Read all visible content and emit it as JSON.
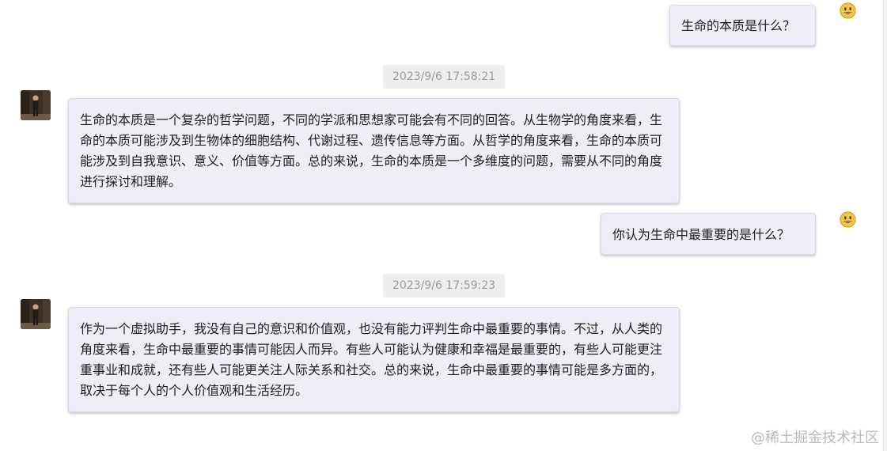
{
  "messages": {
    "q1": {
      "sender_icon": "smiley-icon",
      "text": "生命的本质是什么？"
    },
    "t1": "2023/9/6 17:58:21",
    "a1": {
      "sender_icon": "assistant-avatar",
      "text": "生命的本质是一个复杂的哲学问题，不同的学派和思想家可能会有不同的回答。从生物学的角度来看，生命的本质可能涉及到生物体的细胞结构、代谢过程、遗传信息等方面。从哲学的角度来看，生命的本质可能涉及到自我意识、意义、价值等方面。总的来说，生命的本质是一个多维度的问题，需要从不同的角度进行探讨和理解。"
    },
    "q2": {
      "sender_icon": "smiley-icon",
      "text": "你认为生命中最重要的是什么？"
    },
    "t2": "2023/9/6 17:59:23",
    "a2": {
      "sender_icon": "assistant-avatar",
      "text": "作为一个虚拟助手，我没有自己的意识和价值观，也没有能力评判生命中最重要的事情。不过，从人类的角度来看，生命中最重要的事情可能因人而异。有些人可能认为健康和幸福是最重要的，有些人可能更注重事业和成就，还有些人可能更关注人际关系和社交。总的来说，生命中最重要的事情可能是多方面的，取决于每个人的个人价值观和生活经历。"
    }
  },
  "watermark": "@稀土掘金技术社区",
  "colors": {
    "bubble_bg": "#eeedf8",
    "bubble_border": "#d9d7e8",
    "timestamp_bg": "#eeeeee",
    "timestamp_text": "#9a9a9a",
    "smiley": "#f6c640"
  }
}
